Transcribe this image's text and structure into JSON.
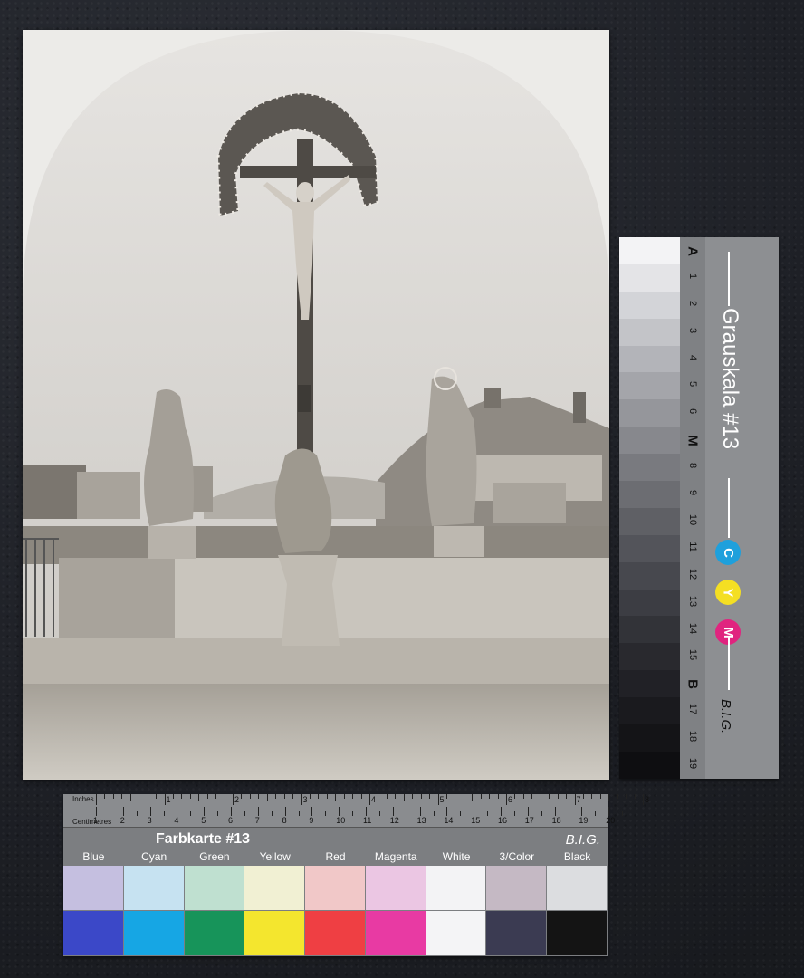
{
  "photo": {
    "subject": "Crucifix with statues on bridge, Graz, Schlossberg in background"
  },
  "grauskala": {
    "title": "Grauskala #13",
    "brand": "B.I.G.",
    "labels": [
      "A",
      "1",
      "2",
      "3",
      "4",
      "5",
      "6",
      "M",
      "8",
      "9",
      "10",
      "11",
      "12",
      "13",
      "14",
      "15",
      "B",
      "17",
      "18",
      "19"
    ],
    "steps": [
      "#f3f3f5",
      "#e4e4e7",
      "#d3d4d8",
      "#c3c4c8",
      "#b3b4b9",
      "#a4a5aa",
      "#95969b",
      "#87888d",
      "#797a7f",
      "#6c6d72",
      "#5f6065",
      "#53545a",
      "#47484e",
      "#3c3d43",
      "#323338",
      "#29292e",
      "#212126",
      "#1a1a1e",
      "#141417",
      "#0e0e11"
    ],
    "cym": [
      {
        "letter": "C",
        "color": "#1ea0dc"
      },
      {
        "letter": "Y",
        "color": "#f4df23"
      },
      {
        "letter": "M",
        "color": "#e0247f"
      }
    ]
  },
  "farbkarte": {
    "title": "Farbkarte #13",
    "brand": "B.I.G.",
    "ruler_inches_label": "Inches",
    "ruler_cm_label": "Centimetres",
    "inch_numbers": [
      "1",
      "2",
      "3",
      "4",
      "5",
      "6",
      "7",
      "8"
    ],
    "cm_numbers": [
      "1",
      "2",
      "3",
      "4",
      "5",
      "6",
      "7",
      "8",
      "9",
      "10",
      "11",
      "12",
      "13",
      "14",
      "15",
      "16",
      "17",
      "18",
      "19",
      "20"
    ],
    "swatches": [
      {
        "name": "Blue",
        "light": "#c5bfe0",
        "dark": "#3b48c8"
      },
      {
        "name": "Cyan",
        "light": "#c6e2f1",
        "dark": "#16a6e4"
      },
      {
        "name": "Green",
        "light": "#bfe0d0",
        "dark": "#17945a"
      },
      {
        "name": "Yellow",
        "light": "#f1f0d3",
        "dark": "#f4e62e"
      },
      {
        "name": "Red",
        "light": "#f1c8c8",
        "dark": "#ef3f43"
      },
      {
        "name": "Magenta",
        "light": "#ebc6e3",
        "dark": "#e83aa3"
      },
      {
        "name": "White",
        "light": "#f3f3f5",
        "dark": "#f4f4f6"
      },
      {
        "name": "3/Color",
        "light": "#c5b9c4",
        "dark": "#3b3b52"
      },
      {
        "name": "Black",
        "light": "#dcdde0",
        "dark": "#141414"
      }
    ]
  }
}
